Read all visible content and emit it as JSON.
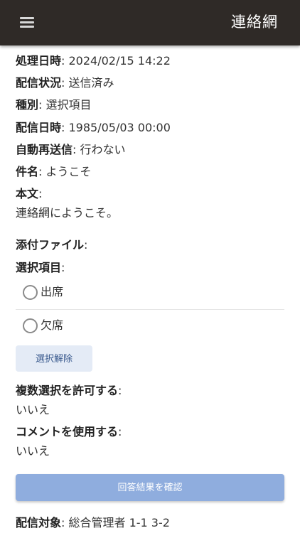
{
  "app_bar": {
    "title": "連絡網",
    "menu_icon": "hamburger-menu-icon"
  },
  "details": {
    "processed_label": "処理日時",
    "processed_value": "2024/02/15 14:22",
    "status_label": "配信状況",
    "status_value": "送信済み",
    "type_label": "種別",
    "type_value": "選択項目",
    "delivery_label": "配信日時",
    "delivery_value": "1985/05/03 00:00",
    "resend_label": "自動再送信",
    "resend_value": "行わない",
    "subject_label": "件名",
    "subject_value": "ようこそ",
    "body_label": "本文",
    "body_value": "連絡網にようこそ。",
    "attachment_label": "添付ファイル",
    "options_label": "選択項目"
  },
  "options": [
    {
      "label": "出席",
      "selected": false
    },
    {
      "label": "欠席",
      "selected": false
    }
  ],
  "buttons": {
    "clear_selection": "選択解除",
    "confirm_results": "回答結果を確認"
  },
  "settings": {
    "multi_label": "複数選択を許可する",
    "multi_value": "いいえ",
    "comment_label": "コメントを使用する",
    "comment_value": "いいえ"
  },
  "recipients": {
    "label": "配信対象",
    "value": "総合管理者 1-1 3-2"
  },
  "colors": {
    "app_bar": "#2f2a27",
    "confirm_button": "#8fadde",
    "clear_button": "#e4ebf6"
  }
}
